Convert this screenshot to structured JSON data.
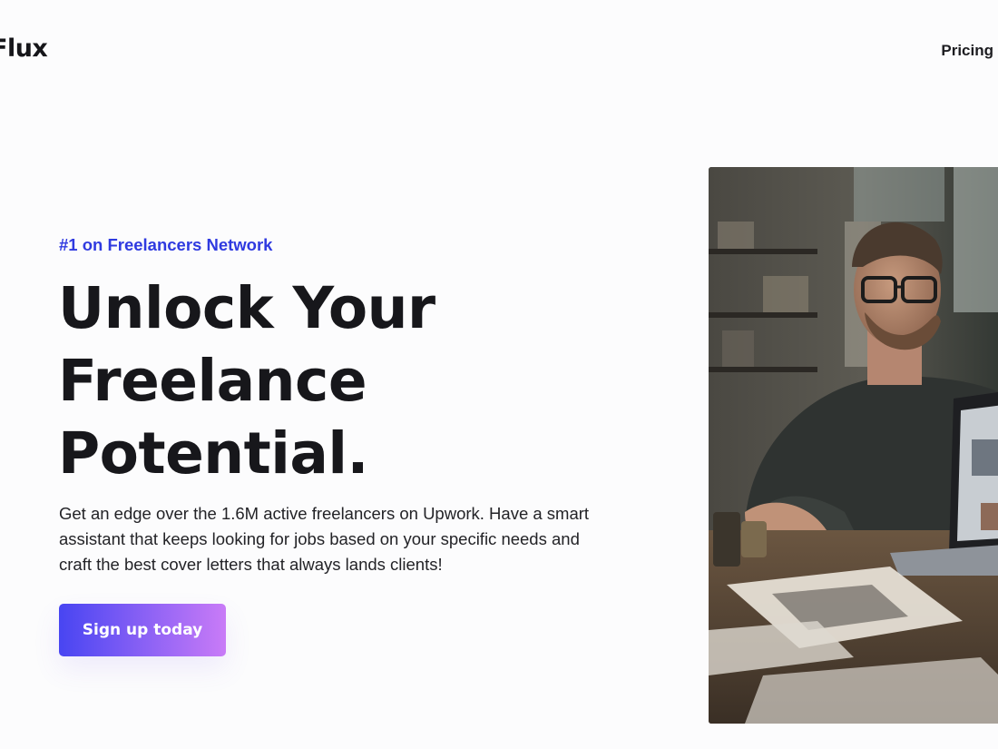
{
  "header": {
    "logo": "Flux",
    "nav": {
      "pricing_label": "Pricing"
    }
  },
  "hero": {
    "eyebrow": "#1 on Freelancers Network",
    "headline_lines": [
      "Unlock Your",
      "Freelance",
      "Potential."
    ],
    "description": "Get an edge over the 1.6M active freelancers on Upwork. Have a smart assistant that keeps looking for jobs based on your specific needs and craft the best cover letters that always lands clients!",
    "cta_label": "Sign up today"
  },
  "colors": {
    "accent": "#2f3ae0",
    "cta_gradient_start": "#4845f2",
    "cta_gradient_end": "#c97bf7",
    "text_primary": "#17171b",
    "background": "#fcfcfd"
  }
}
